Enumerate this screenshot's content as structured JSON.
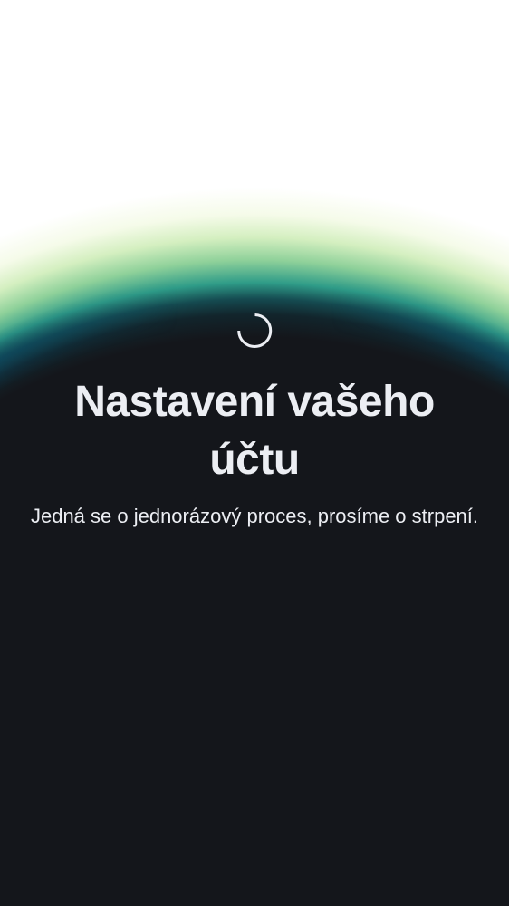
{
  "loading": {
    "spinner_icon": "loading-spinner-icon",
    "accent_colors": [
      "#14161b",
      "#2f9c88",
      "#8fd19a",
      "#0a4664"
    ]
  },
  "title": "Nastavení vašeho účtu",
  "subtitle": "Jedná se o jednorázový proces, prosíme o strpení."
}
